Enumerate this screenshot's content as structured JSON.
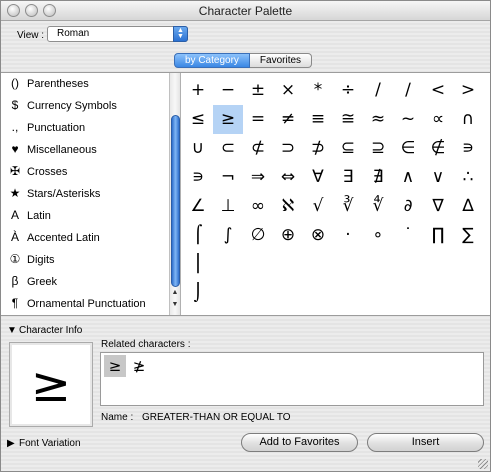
{
  "window": {
    "title": "Character Palette"
  },
  "view": {
    "label": "View :",
    "selected": "Roman"
  },
  "tabs": [
    {
      "label": "by Category",
      "active": true
    },
    {
      "label": "Favorites",
      "active": false
    }
  ],
  "categories": [
    {
      "icon": "()",
      "label": "Parentheses"
    },
    {
      "icon": "$",
      "label": "Currency Symbols"
    },
    {
      "icon": ".,",
      "label": "Punctuation"
    },
    {
      "icon": "♥",
      "label": "Miscellaneous"
    },
    {
      "icon": "✠",
      "label": "Crosses"
    },
    {
      "icon": "★",
      "label": "Stars/Asterisks"
    },
    {
      "icon": "A",
      "label": "Latin"
    },
    {
      "icon": "À",
      "label": "Accented Latin"
    },
    {
      "icon": "①",
      "label": "Digits"
    },
    {
      "icon": "β",
      "label": "Greek"
    },
    {
      "icon": "¶",
      "label": "Ornamental Punctuation"
    }
  ],
  "symbols": [
    [
      "+",
      "−",
      "±",
      "×",
      "*",
      "÷",
      "/",
      "∕",
      "<",
      ">"
    ],
    [
      "≤",
      "≥",
      "=",
      "≠",
      "≡",
      "≅",
      "≈",
      "~",
      "∝",
      "∩"
    ],
    [
      "∪",
      "⊂",
      "⊄",
      "⊃",
      "⊅",
      "⊆",
      "⊇",
      "∈",
      "∉",
      "∍"
    ],
    [
      "∍",
      "¬",
      "⇒",
      "⇔",
      "∀",
      "∃",
      "∄",
      "∧",
      "∨",
      "∴"
    ],
    [
      "∠",
      "⊥",
      "∞",
      "ℵ",
      "√",
      "∛",
      "∜",
      "∂",
      "∇",
      "∆"
    ],
    [
      "⌠",
      "∫",
      "∅",
      "⊕",
      "⊗",
      "·",
      "∘",
      "˙",
      "∏",
      "∑"
    ],
    [
      "⎮",
      "",
      "",
      "",
      "",
      "",
      "",
      "",
      "",
      ""
    ],
    [
      "⌡",
      "",
      "",
      "",
      "",
      "",
      "",
      "",
      "",
      ""
    ]
  ],
  "selected_symbol": "≥",
  "character_info": {
    "label": "Character Info",
    "related_label": "Related characters :",
    "related": [
      "≥",
      "≱"
    ],
    "name_label": "Name :",
    "name_value": "GREATER-THAN OR EQUAL TO"
  },
  "font_variation": {
    "label": "Font Variation"
  },
  "buttons": {
    "add_favorites": "Add to Favorites",
    "insert": "Insert"
  },
  "icons": {
    "disclosure_open": "disclosure-triangle-open-icon",
    "disclosure_closed": "disclosure-triangle-closed-icon"
  }
}
